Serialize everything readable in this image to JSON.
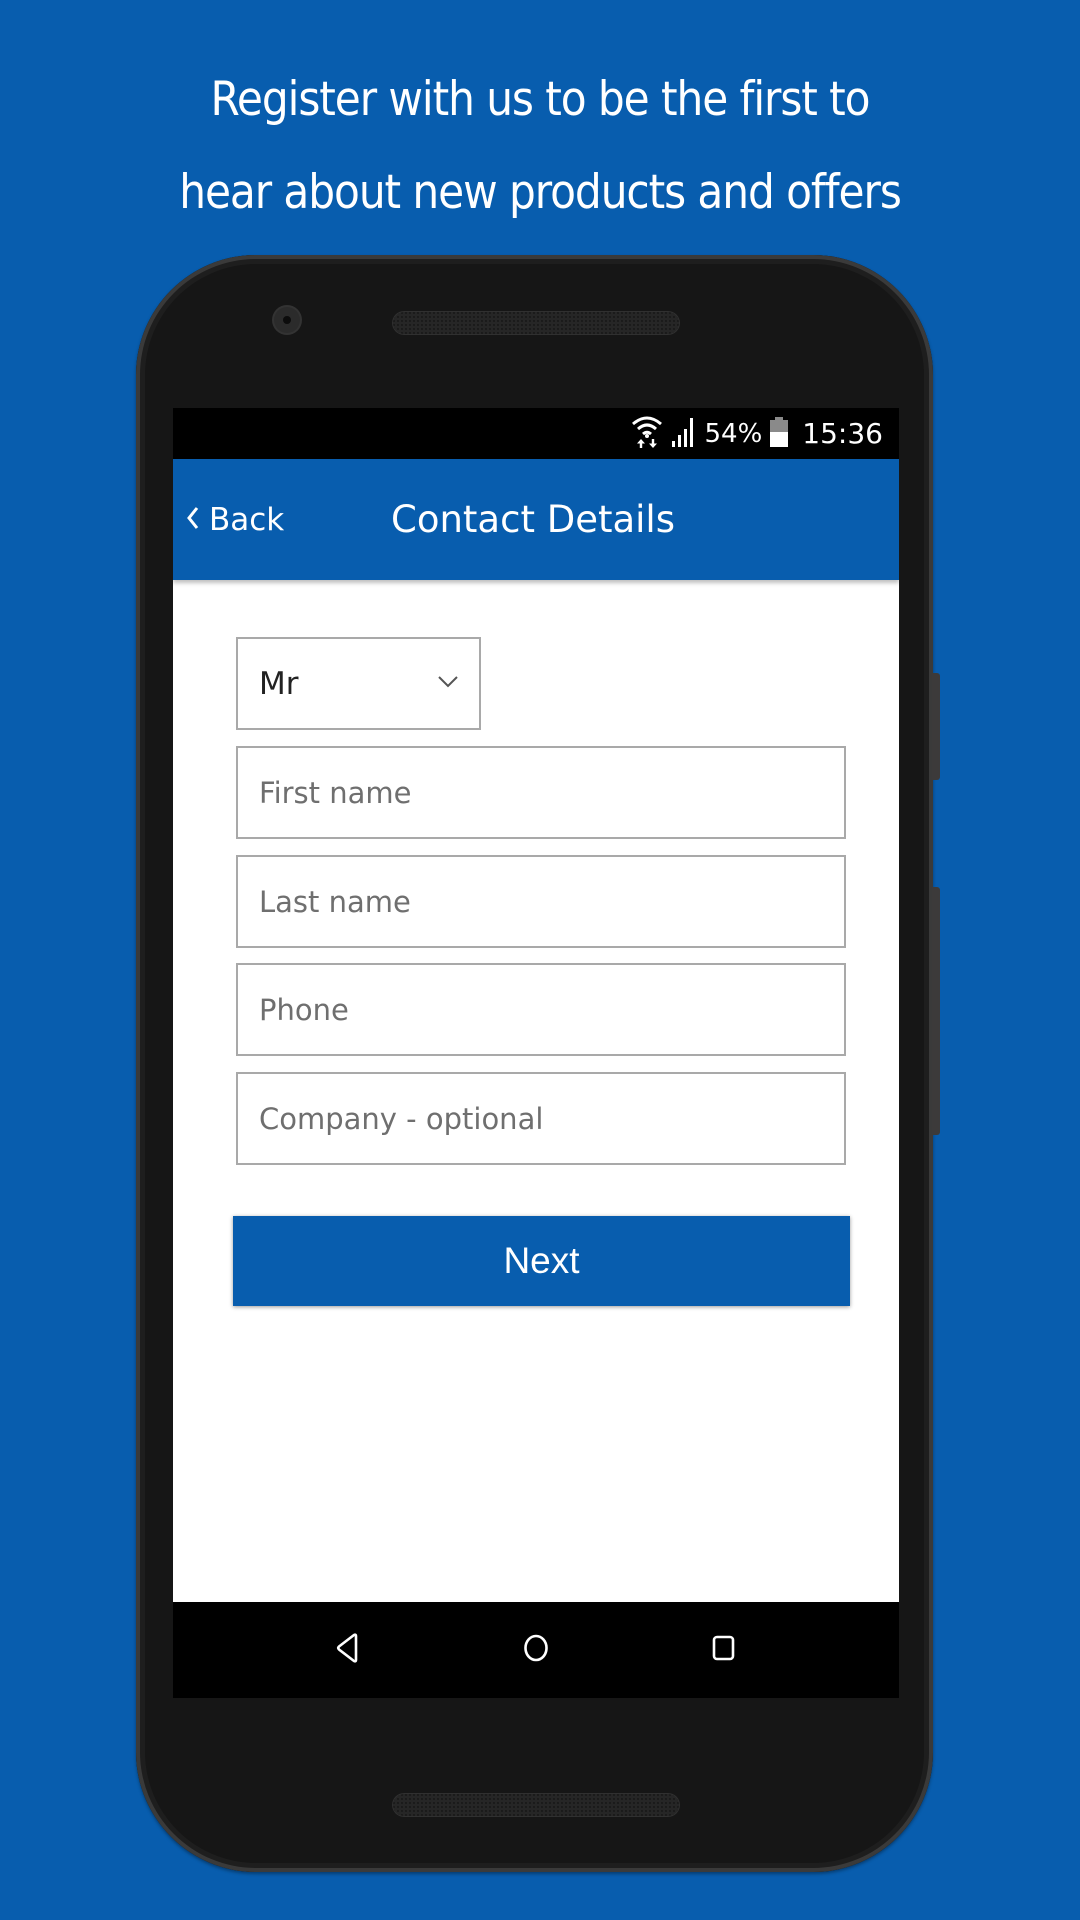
{
  "promo": {
    "line1": "Register with us to be the first to",
    "line2": "hear about new products and offers"
  },
  "status_bar": {
    "wifi_icon": "wifi-icon",
    "signal_icon": "cell-signal-icon",
    "battery_percent": "54%",
    "battery_icon": "battery-icon",
    "time": "15:36"
  },
  "app_bar": {
    "back_label": "Back",
    "title": "Contact Details"
  },
  "form": {
    "title_select": {
      "value": "Mr"
    },
    "first_name": {
      "value": "",
      "placeholder": "First name"
    },
    "last_name": {
      "value": "",
      "placeholder": "Last name"
    },
    "phone": {
      "value": "",
      "placeholder": "Phone"
    },
    "company": {
      "value": "",
      "placeholder": "Company - optional"
    },
    "next_label": "Next"
  },
  "nav_bar": {
    "back_icon": "nav-back-icon",
    "home_icon": "nav-home-icon",
    "recents_icon": "nav-recents-icon"
  },
  "colors": {
    "brand_blue": "#085DAE",
    "background": "#085DAE",
    "field_border": "#A9A9A9",
    "placeholder": "#6F6F6F"
  }
}
